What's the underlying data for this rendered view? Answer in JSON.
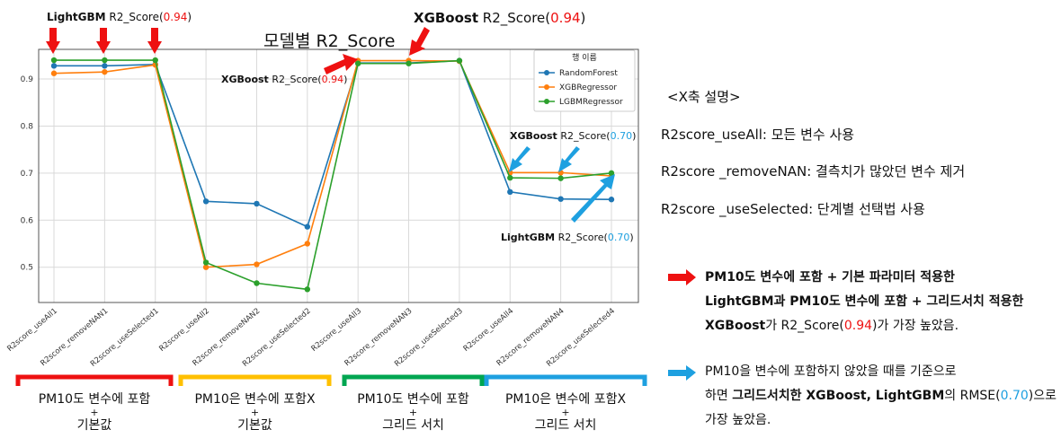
{
  "chart_data": {
    "type": "line",
    "title": "모델별 R2_Score",
    "categories": [
      "R2score_useAll1",
      "R2score_removeNAN1",
      "R2score_useSelected1",
      "R2score_useAll2",
      "R2score_removeNAN2",
      "R2score_useSelected2",
      "R2score_useAll3",
      "R2score_removeNAN3",
      "R2score_useSelected3",
      "R2score_useAll4",
      "R2score_removeNAN4",
      "R2score_useSelected4"
    ],
    "series": [
      {
        "name": "RandomForest",
        "color": "#1f77b4",
        "values": [
          0.928,
          0.928,
          0.931,
          0.64,
          0.635,
          0.586,
          0.934,
          0.934,
          0.939,
          0.66,
          0.645,
          0.644
        ]
      },
      {
        "name": "XGBRegressor",
        "color": "#ff7f0e",
        "values": [
          0.912,
          0.915,
          0.93,
          0.5,
          0.506,
          0.55,
          0.939,
          0.939,
          0.938,
          0.701,
          0.701,
          0.694
        ]
      },
      {
        "name": "LGBMRegressor",
        "color": "#2ca02c",
        "values": [
          0.94,
          0.94,
          0.94,
          0.51,
          0.466,
          0.453,
          0.933,
          0.933,
          0.939,
          0.69,
          0.689,
          0.7
        ]
      }
    ],
    "yticks": [
      0.5,
      0.6,
      0.7,
      0.8,
      0.9
    ],
    "ylim": [
      0.425,
      0.963
    ],
    "grid": true,
    "legend": {
      "title": "행 이름",
      "placement": "top-right"
    }
  },
  "annotations": {
    "lgbm_top": {
      "model": "LightGBM",
      "metric": " R2_Score(",
      "value": "0.94",
      "close": ")"
    },
    "xgb_top": {
      "model": "XGBoost",
      "metric": " R2_Score(",
      "value": "0.94",
      "close": ")"
    },
    "xgb_mid": {
      "model": "XGBoost",
      "metric": " R2_Score(",
      "value": "0.94",
      "close": ")"
    },
    "xgb_right": {
      "model": "XGBoost",
      "metric": "  R2_Score(",
      "value": "0.70",
      "close": ")"
    },
    "lgbm_right": {
      "model": "LightGBM",
      "metric": "  R2_Score(",
      "value": "0.70",
      "close": ")"
    }
  },
  "groups": [
    {
      "line1": "PM10도 변수에 포함",
      "plus": "+",
      "line2": "기본값",
      "color": "#ee1111"
    },
    {
      "line1": "PM10은 변수에 포함X",
      "plus": "+",
      "line2": "기본값",
      "color": "#ffc000"
    },
    {
      "line1": "PM10도 변수에 포함",
      "plus": "+",
      "line2": "그리드 서치",
      "color": "#00a651"
    },
    {
      "line1": "PM10은 변수에 포함X",
      "plus": "+",
      "line2": "그리드 서치",
      "color": "#1ea0e0"
    }
  ],
  "xaxis_desc": {
    "heading": "<X축 설명>",
    "items": [
      "R2score_useAll: 모든 변수 사용",
      "R2score _removeNAN: 결측치가 많았던 변수 제거",
      "R2score _useSelected: 단계별 선택법 사용"
    ]
  },
  "notes": {
    "red_note": {
      "l1": "PM10도 변수에 포함 + 기본 파라미터 적용한",
      "l2": "LightGBM과 PM10도 변수에 포함 + 그리드서치 적용한",
      "l3_bold": "XGBoost",
      "l3_rest": "가 R2_Score(",
      "l3_value": "0.94",
      "l3_tail": ")가 가장 높았음."
    },
    "blue_note": {
      "l1": "PM10을 변수에 포함하지 않았을 때를 기준으로",
      "l2_a": "하면 ",
      "l2_bold": "그리드서치한 XGBoost, LightGBM",
      "l2_rest": "의 RMSE(",
      "l2_value": "0.70",
      "l2_tail": ")으로",
      "l3": "가장 높았음."
    }
  },
  "colors": {
    "red_arrow": "#ee1111",
    "blue_arrow": "#1ea0e0"
  }
}
